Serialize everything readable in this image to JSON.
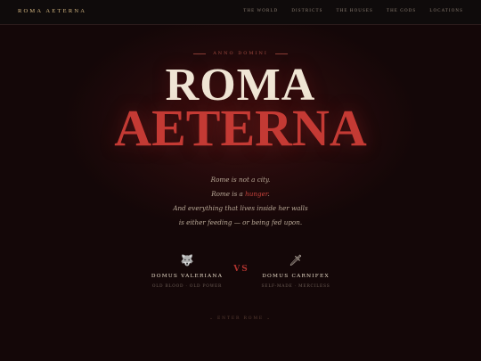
{
  "header": {
    "logo": "ROMA AETERNA",
    "nav": [
      "THE WORLD",
      "DISTRICTS",
      "THE HOUSES",
      "THE GODS",
      "LOCATIONS"
    ]
  },
  "hero": {
    "eyebrow": "ANNO DOMINI",
    "title_line1": "ROMA",
    "title_line2": "AETERNA"
  },
  "poem": {
    "line1": "Rome is not a city.",
    "line2_prefix": "Rome is a ",
    "line2_emphasis": "hunger",
    "line2_suffix": ".",
    "line3": "And everything that lives inside her walls",
    "line4": "is either feeding — or being fed upon."
  },
  "houses": {
    "left": {
      "icon": "wolf-icon",
      "glyph": "🐺",
      "name": "DOMUS VALERIANA",
      "tagline": "OLD BLOOD · OLD POWER"
    },
    "vs": "VS",
    "right": {
      "icon": "dagger-icon",
      "glyph": "🗡",
      "name": "DOMUS CARNIFEX",
      "tagline": "SELF-MADE · MERCILESS"
    }
  },
  "cta": {
    "label": "⌄ ENTER ROME ⌄"
  },
  "colors": {
    "accent": "#c43a34",
    "gold": "#d6b882",
    "background": "#140708"
  }
}
